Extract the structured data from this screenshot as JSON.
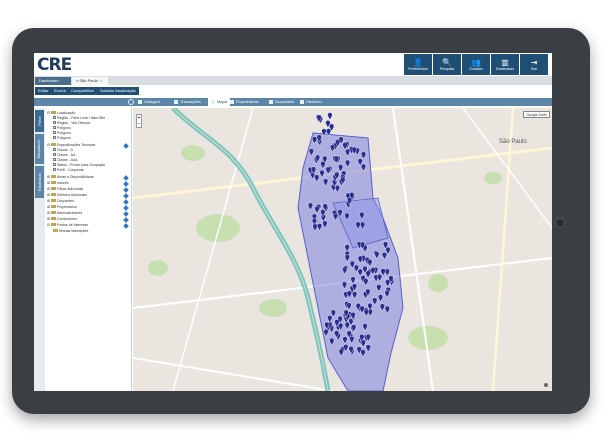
{
  "app": {
    "logo": "CRE",
    "toolbar": [
      {
        "label": "Preferências",
        "glyph": "👤",
        "icon": "user-icon"
      },
      {
        "label": "Pesquisa",
        "glyph": "🔍",
        "icon": "search-icon"
      },
      {
        "label": "Contatos",
        "glyph": "👥",
        "icon": "contacts-icon"
      },
      {
        "label": "Estatísticas",
        "glyph": "▥",
        "icon": "stats-icon"
      },
      {
        "label": "Sair",
        "glyph": "⇥",
        "icon": "exit-icon"
      }
    ]
  },
  "tabs": {
    "dashboard": "Dashboard",
    "location": "São Paulo"
  },
  "actions": {
    "editar": "Editar",
    "excluir": "Excluir",
    "compartilhar": "Compartilhar",
    "atualizacao": "Solicitar Atualização"
  },
  "modes": {
    "listagem": "Listagem",
    "transacoes": "Transações",
    "mapa": "Mapa",
    "proprietarios": "Proprietários",
    "ocupantes": "Ocupantes",
    "historico": "Histórico"
  },
  "sidebar": {
    "vtabs": [
      "Filtros",
      "Marcadores",
      "Estatísticas"
    ],
    "tree": [
      "Localização",
      "Região - Faria Lima / Itaim Bibi",
      "Região - Vila Olímpia",
      "Polígono",
      "Polígono",
      "Polígono",
      "Especificações Técnicas",
      "Classe - A",
      "Classe - AA",
      "Classe - AAA",
      "Status - Pronto para Ocupação",
      "Perfil - Corporate",
      "Áreas e Disponibilidade",
      "Valores",
      "Filtros Adicionais",
      "Edifícios Adicionais",
      "Ocupantes",
      "Proprietários",
      "Administradores",
      "Construtores",
      "Pontos de Interesse",
      "Minhas Marcações"
    ]
  },
  "map": {
    "google_earth": "Google Earth",
    "city_label": "São Paulo",
    "zoom_in": "+",
    "zoom_out": "−",
    "accent_color": "#2b2f8f",
    "polygon_color": "#7b82e0"
  }
}
